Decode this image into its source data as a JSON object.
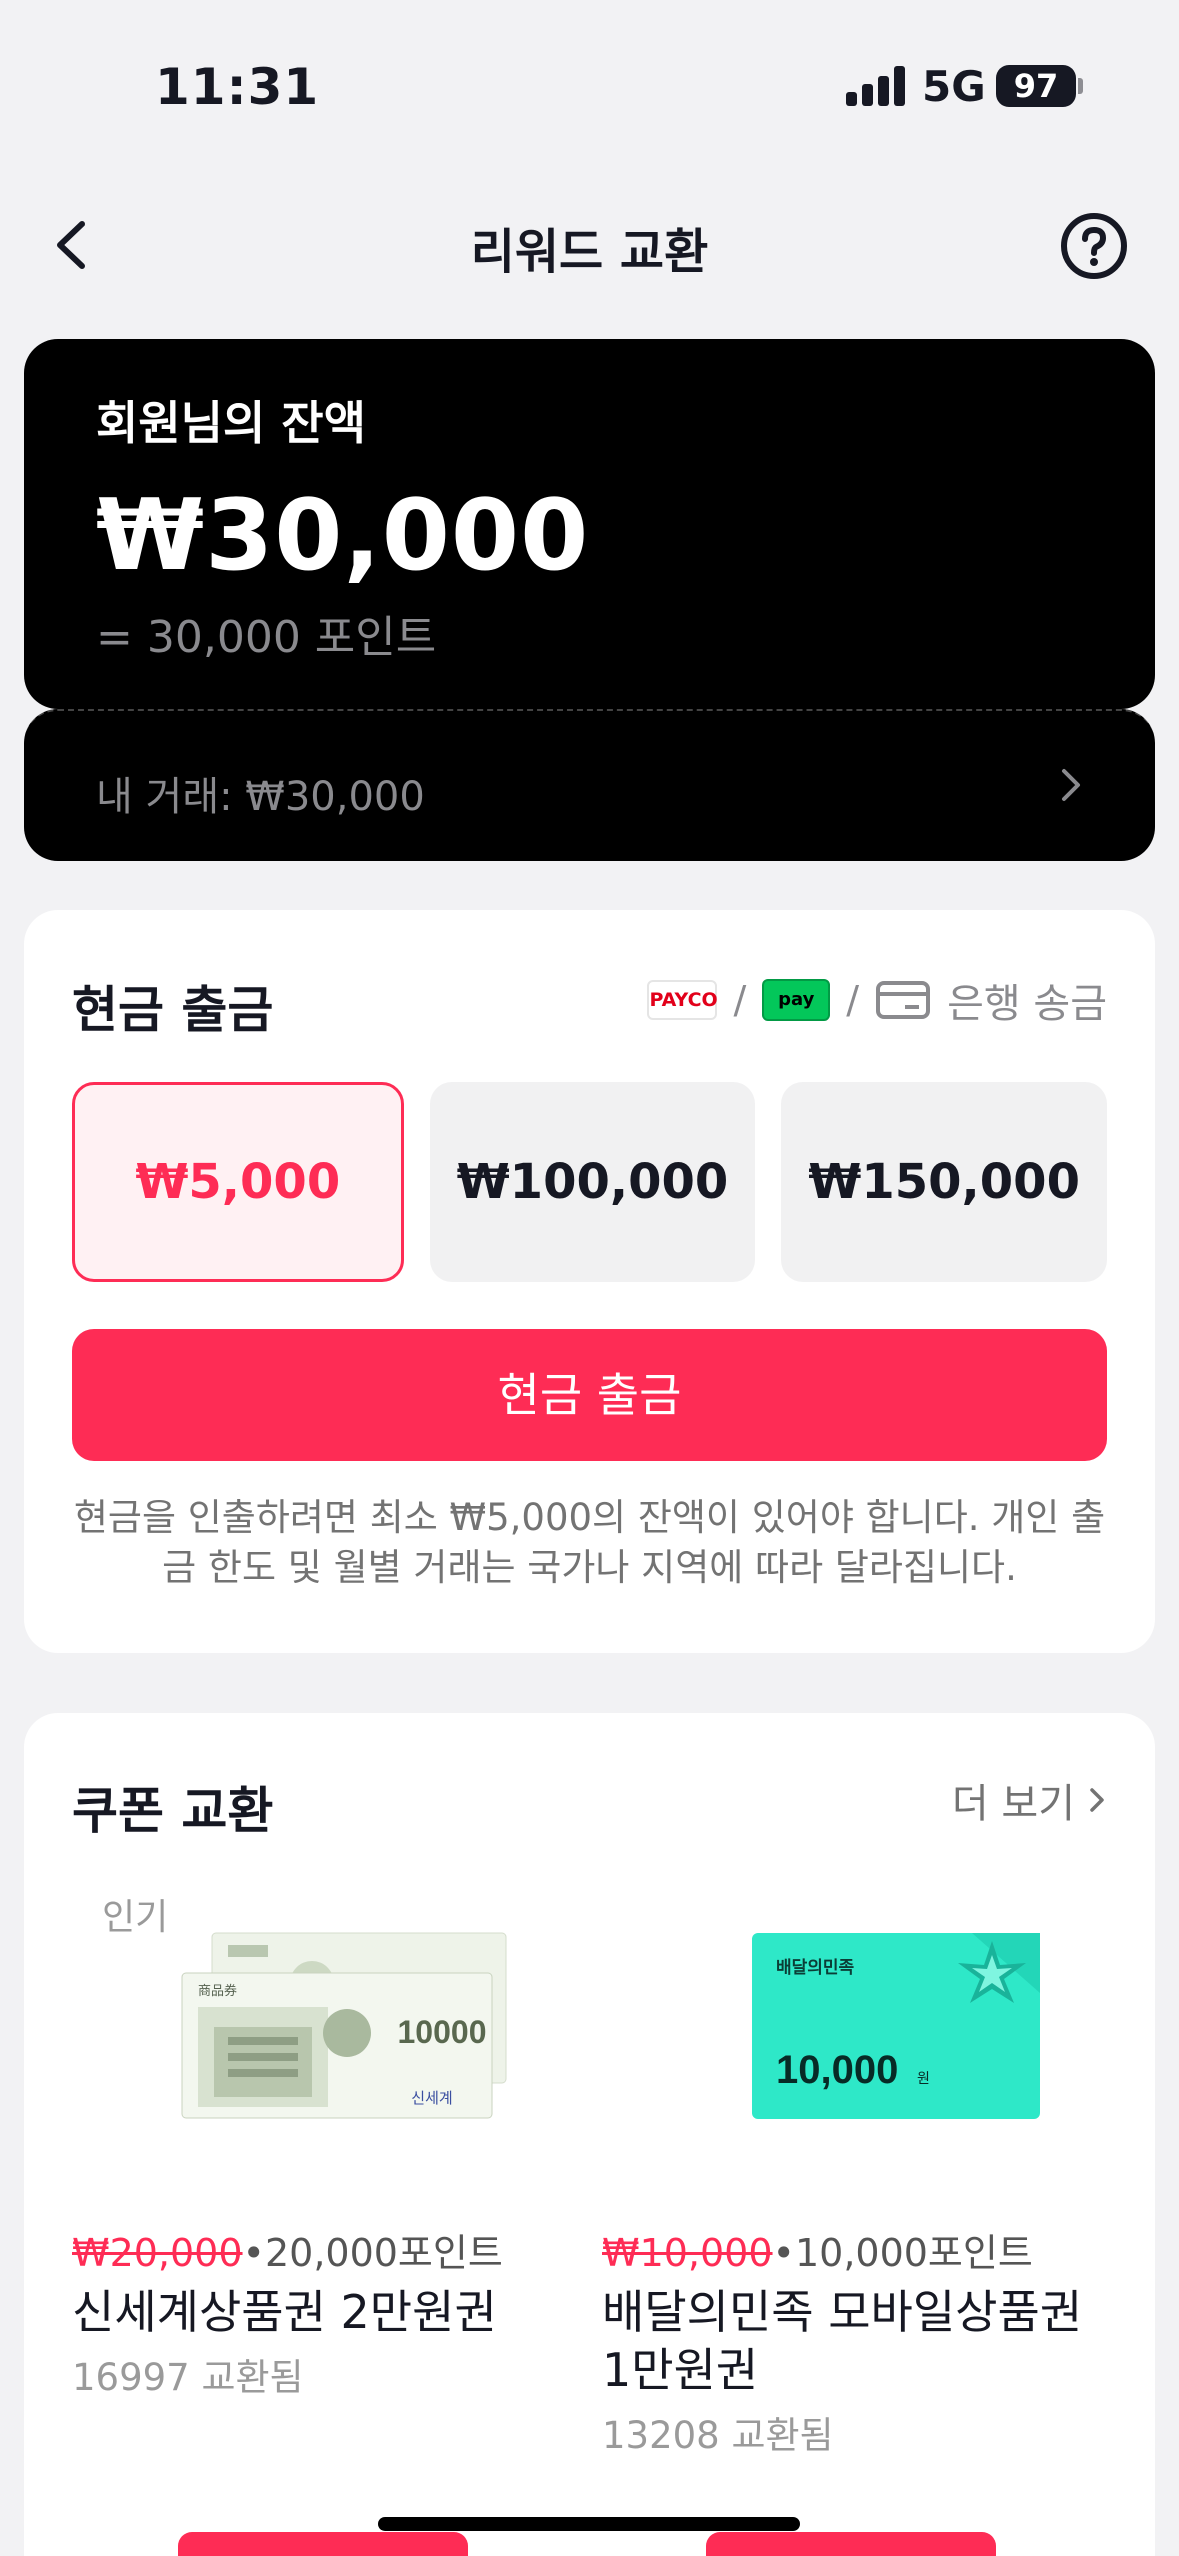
{
  "status": {
    "time": "11:31",
    "network": "5G",
    "battery": "97"
  },
  "header": {
    "title": "리워드 교환"
  },
  "balance": {
    "label": "회원님의 잔액",
    "amount": "₩30,000",
    "points": "= 30,000 포인트",
    "transactions": "내 거래: ₩30,000"
  },
  "cash": {
    "title": "현금 출금",
    "methods": {
      "payco": "PAYCO",
      "npay": "pay",
      "bank": "은행 송금"
    },
    "amounts": [
      "₩5,000",
      "₩100,000",
      "₩150,000"
    ],
    "selected_index": 0,
    "button": "현금 출금",
    "note": "현금을 인출하려면 최소 ₩5,000의 잔액이 있어야 합니다. 개인 출금 한도 및 월별 거래는 국가나 지역에 따라 달라집니다."
  },
  "coupons": {
    "title": "쿠폰 교환",
    "more": "더 보기",
    "popular_tag": "인기",
    "items": [
      {
        "old_price": "₩20,000",
        "points": "•20,000포인트",
        "name": "신세계상품권 2만원권",
        "count": "16997 교환됨",
        "image_text": "10000",
        "image_brand": "신세계",
        "image_small": "商品券"
      },
      {
        "old_price": "₩10,000",
        "points": "•10,000포인트",
        "name": "배달의민족 모바일상품권 1만원권",
        "count": "13208 교환됨",
        "image_brand": "배달의민족",
        "image_value": "10,000",
        "image_unit": "원"
      }
    ]
  },
  "colors": {
    "accent": "#fe2c55",
    "card_dark": "#000000",
    "baemin": "#2ee8c8"
  }
}
